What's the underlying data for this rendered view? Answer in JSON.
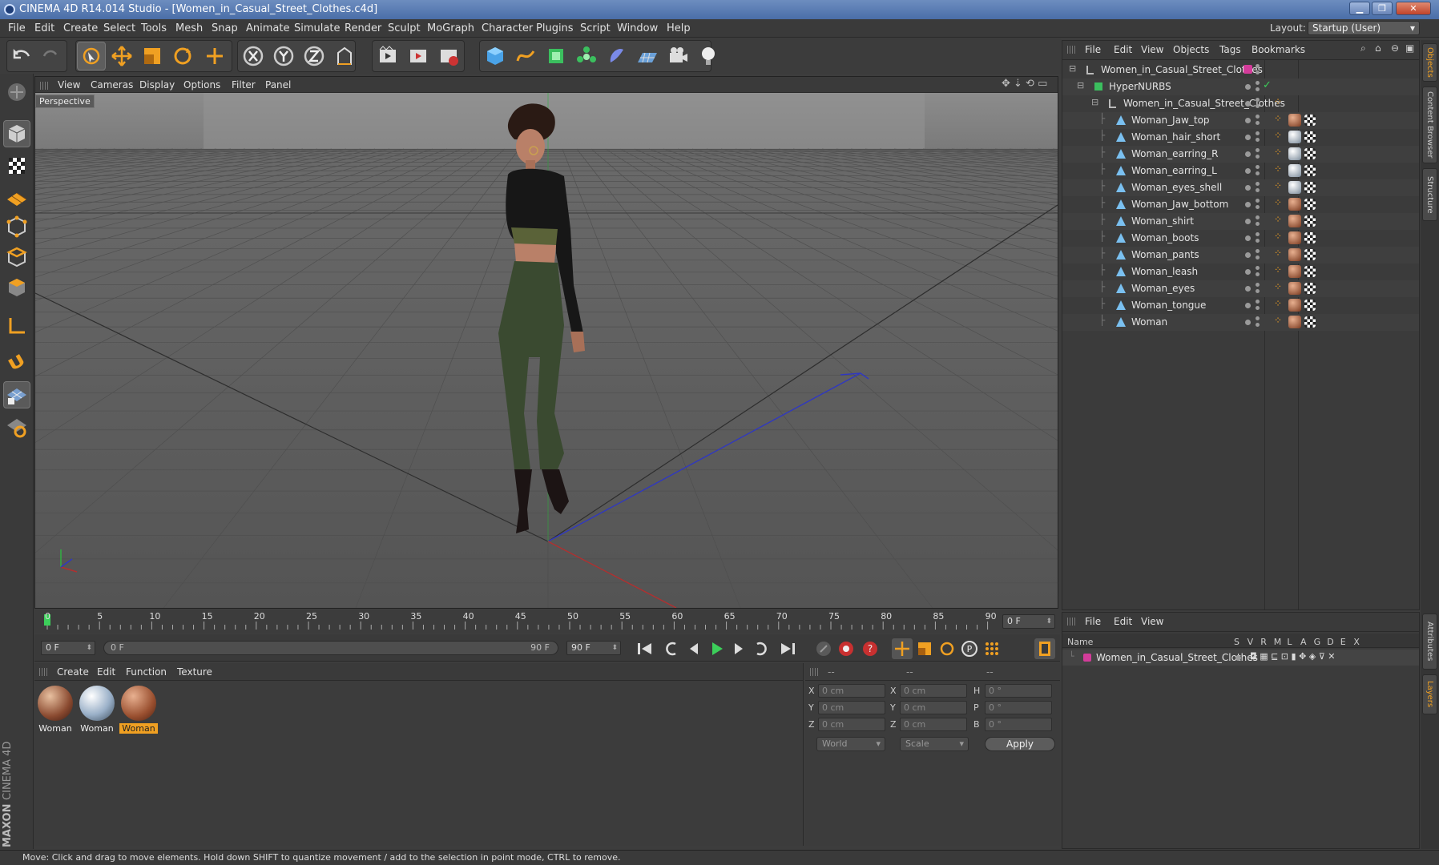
{
  "window": {
    "title": "CINEMA 4D R14.014 Studio - [Women_in_Casual_Street_Clothes.c4d]"
  },
  "menubar": {
    "items": [
      "File",
      "Edit",
      "Create",
      "Select",
      "Tools",
      "Mesh",
      "Snap",
      "Animate",
      "Simulate",
      "Render",
      "Sculpt",
      "MoGraph",
      "Character",
      "Plugins",
      "Script",
      "Window",
      "Help"
    ],
    "layout_label": "Layout:",
    "layout_value": "Startup (User)"
  },
  "viewport": {
    "menu": [
      "View",
      "Cameras",
      "Display",
      "Options",
      "Filter",
      "Panel"
    ],
    "view_name": "Perspective"
  },
  "timeline": {
    "ticks": [
      "0",
      "5",
      "10",
      "15",
      "20",
      "25",
      "30",
      "35",
      "40",
      "45",
      "50",
      "55",
      "60",
      "65",
      "70",
      "75",
      "80",
      "85",
      "90"
    ],
    "current_frame": "0 F"
  },
  "transport": {
    "start_field": "0 F",
    "range_start": "0 F",
    "range_end": "90 F",
    "end_field": "90 F"
  },
  "materials": {
    "menu": [
      "Create",
      "Edit",
      "Function",
      "Texture"
    ],
    "items": [
      {
        "label": "Woman",
        "active": false
      },
      {
        "label": "Woman",
        "active": false
      },
      {
        "label": "Woman",
        "active": true
      }
    ]
  },
  "coordinates": {
    "header": [
      "--",
      "--",
      "--"
    ],
    "rows": [
      {
        "a": "X",
        "av": "0 cm",
        "b": "X",
        "bv": "0 cm",
        "c": "H",
        "cv": "0 °"
      },
      {
        "a": "Y",
        "av": "0 cm",
        "b": "Y",
        "bv": "0 cm",
        "c": "P",
        "cv": "0 °"
      },
      {
        "a": "Z",
        "av": "0 cm",
        "b": "Z",
        "bv": "0 cm",
        "c": "B",
        "cv": "0 °"
      }
    ],
    "mode1": "World",
    "mode2": "Scale",
    "apply": "Apply"
  },
  "objects": {
    "menu": [
      "File",
      "Edit",
      "View",
      "Objects",
      "Tags",
      "Bookmarks"
    ],
    "root": "Women_in_Casual_Street_Clothes",
    "hypernurbs": "HyperNURBS",
    "group": "Women_in_Casual_Street_Clothes",
    "meshes": [
      "Woman_Jaw_top",
      "Woman_hair_short",
      "Woman_earring_R",
      "Woman_earring_L",
      "Woman_eyes_shell",
      "Woman_Jaw_bottom",
      "Woman_shirt",
      "Woman_boots",
      "Woman_pants",
      "Woman_leash",
      "Woman_eyes",
      "Woman_tongue",
      "Woman"
    ]
  },
  "layers": {
    "menu": [
      "File",
      "Edit",
      "View"
    ],
    "name_col": "Name",
    "cols": [
      "S",
      "V",
      "R",
      "M",
      "L",
      "A",
      "G",
      "D",
      "E",
      "X"
    ],
    "item": "Women_in_Casual_Street_Clothes"
  },
  "right_tabs": [
    "Objects",
    "Content Browser",
    "Structure",
    "Attributes",
    "Layers"
  ],
  "brand": {
    "maxon": "MAXON",
    "c4d": "CINEMA 4D"
  },
  "status": "Move: Click and drag to move elements. Hold down SHIFT to quantize movement / add to the selection in point mode, CTRL to remove."
}
